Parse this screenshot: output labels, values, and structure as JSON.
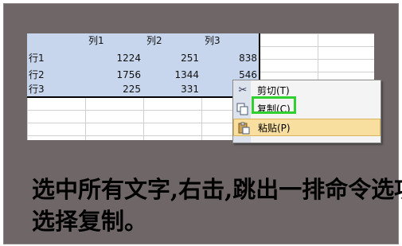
{
  "table": {
    "headers": [
      "列1",
      "列2",
      "列3"
    ],
    "rows": [
      {
        "label": "行1",
        "values": [
          "1224",
          "251",
          "838"
        ]
      },
      {
        "label": "行2",
        "values": [
          "1756",
          "1344",
          "546"
        ]
      },
      {
        "label": "行3",
        "values": [
          "225",
          "331",
          ""
        ]
      }
    ]
  },
  "context_menu": {
    "items": [
      {
        "label": "剪切(T)",
        "icon": "scissors-icon"
      },
      {
        "label": "复制(C)",
        "icon": "copy-icon"
      },
      {
        "label": "粘贴(P)",
        "icon": "paste-icon"
      }
    ],
    "highlighted_item": "粘贴(P)",
    "callout_color": "#2fd02f"
  },
  "caption": {
    "line1": "选中所有文字,右击,跳出一排命令选项",
    "line2": "选择复制。"
  }
}
